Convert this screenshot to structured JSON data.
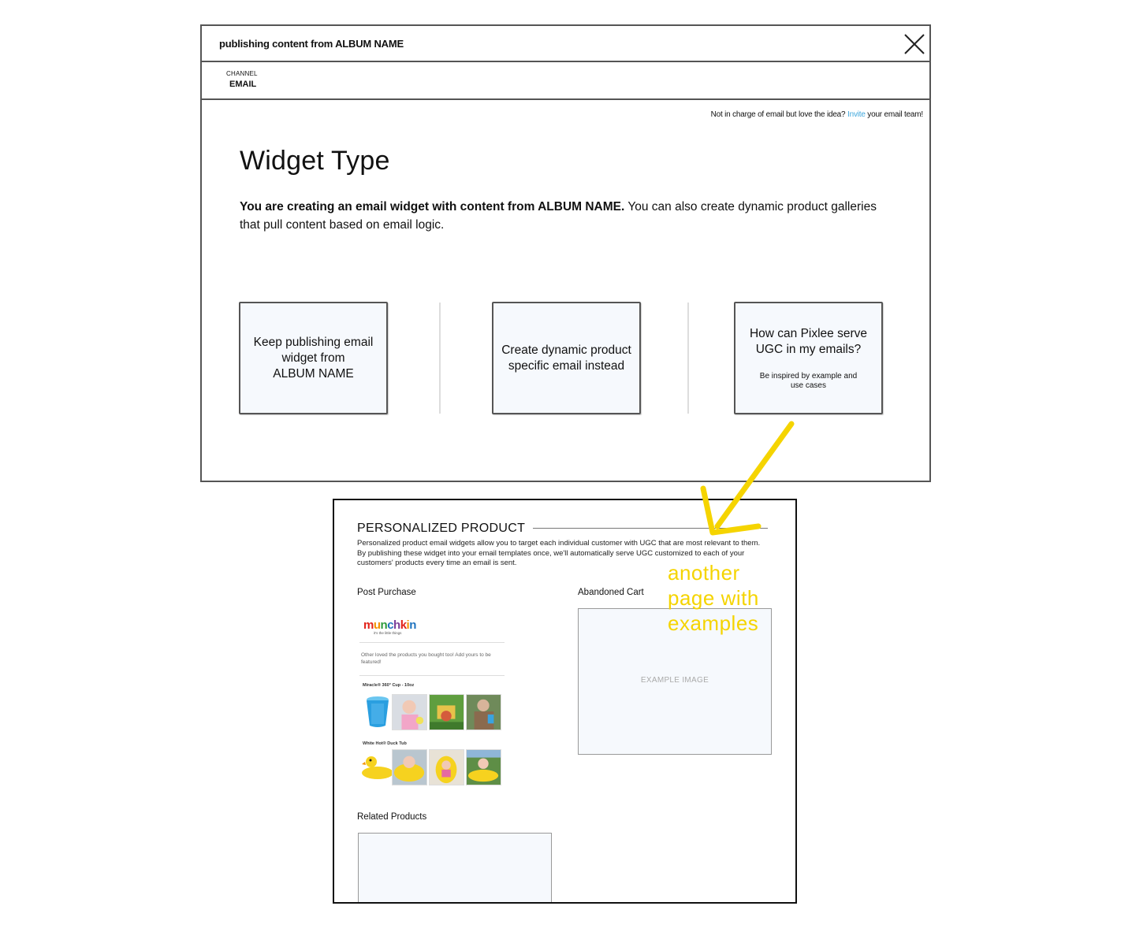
{
  "modal": {
    "title": "publishing content from ALBUM NAME",
    "channel_label": "CHANNEL",
    "channel_value": "EMAIL",
    "invite_prefix": "Not in charge of email but love the idea? ",
    "invite_link": "Invite",
    "invite_suffix": " your email team!",
    "heading": "Widget Type",
    "intro_bold": "You are creating an email widget with content from ALBUM NAME.",
    "intro_rest": " You can also create dynamic product galleries that pull content based on email logic.",
    "cards": [
      {
        "line1": "Keep publishing email",
        "line2": "widget from",
        "line3": "ALBUM NAME"
      },
      {
        "line1": "Create dynamic product",
        "line2": "specific email instead"
      },
      {
        "line1": "How can Pixlee serve",
        "line2": "UGC in my emails?",
        "sub1": "Be inspired by example and",
        "sub2": "use cases"
      }
    ]
  },
  "example_page": {
    "heading": "PERSONALIZED PRODUCT",
    "description": "Personalized product email widgets allow you to target each individual customer with UGC that are most relevant to them. By publishing these widget into your email templates once, we'll automatically serve UGC customized to each of your customers' products every time an email is sent.",
    "post_purchase": "Post Purchase",
    "abandoned_cart": "Abandoned Cart",
    "related_products": "Related Products",
    "example_image": "EXAMPLE IMAGE",
    "email_preview": {
      "logo": "munchkin",
      "tagline": "it's the little things",
      "copy": "Other loved the products you bought too! Add yours to be featured!",
      "product1": "Miracle® 360° Cup - 10oz",
      "product2": "White Hot® Duck Tub"
    }
  },
  "annotation": {
    "line1": "another",
    "line2": "page with",
    "line3": "examples"
  },
  "colors": {
    "accent_link": "#3fa7dc",
    "annotation": "#f5d400",
    "card_bg": "#f6f9fd"
  }
}
